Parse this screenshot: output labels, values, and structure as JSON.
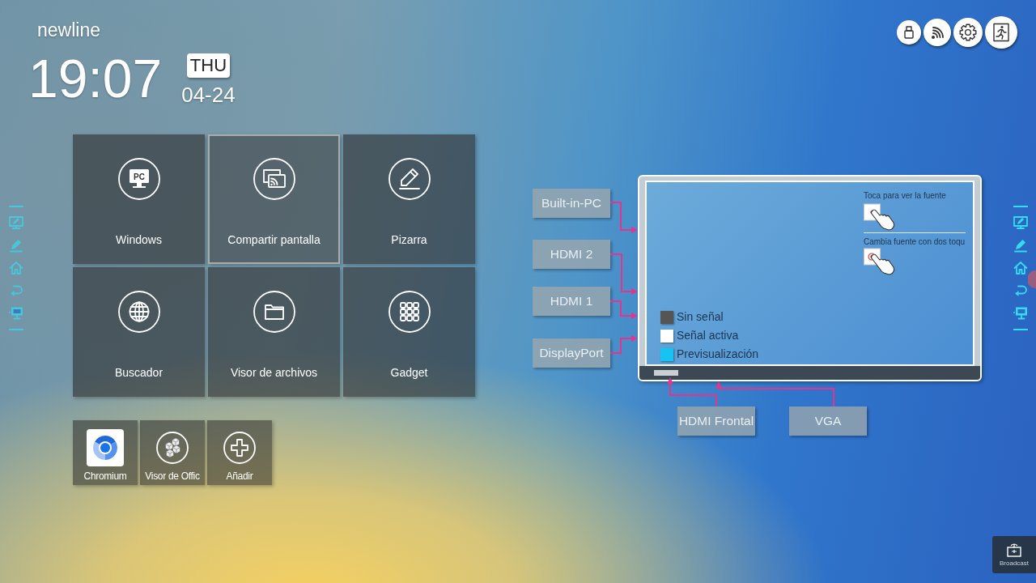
{
  "brand": {
    "logo": "newline"
  },
  "clock": {
    "time": "19:07",
    "weekday": "THU",
    "date": "04-24"
  },
  "tiles": [
    {
      "label": "Windows",
      "icon_text": "PC",
      "selected": false
    },
    {
      "label": "Compartir pantalla",
      "selected": true
    },
    {
      "label": "Pizarra",
      "selected": false
    },
    {
      "label": "Buscador",
      "selected": false
    },
    {
      "label": "Visor de archivos",
      "selected": false
    },
    {
      "label": "Gadget",
      "selected": false
    }
  ],
  "apps": [
    {
      "label": "Chromium"
    },
    {
      "label": "Visor de Offic"
    },
    {
      "label": "Añadir"
    }
  ],
  "input_diagram": {
    "sources": [
      {
        "label": "Built-in-PC"
      },
      {
        "label": "HDMI 2"
      },
      {
        "label": "HDMI 1"
      },
      {
        "label": "DisplayPort"
      },
      {
        "label": "HDMI Frontal"
      },
      {
        "label": "VGA"
      }
    ],
    "legend": [
      {
        "label": "Sin señal",
        "color": "#555555"
      },
      {
        "label": "Señal activa",
        "color": "#ffffff"
      },
      {
        "label": "Previsualización",
        "color": "#17c3f2"
      }
    ],
    "hints": [
      {
        "text": "Toca para ver la fuente"
      },
      {
        "text": "Cambia fuente con dos toqu"
      }
    ]
  },
  "broadcast": {
    "label": "Broadcast"
  }
}
